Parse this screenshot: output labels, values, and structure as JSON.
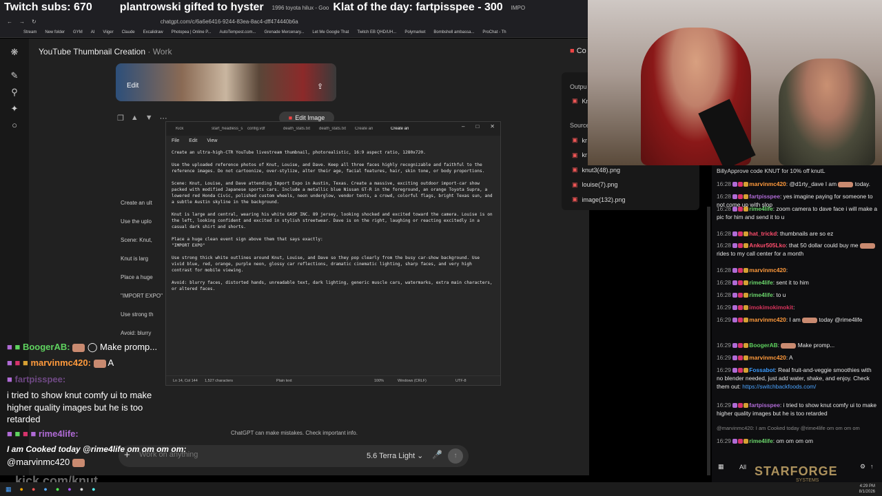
{
  "overlay_top": {
    "subs": "Twitch subs: 670",
    "gift": "plantrowski gifted to hyster",
    "tab1": "1996 toyota hilux - Goo",
    "klat": "Klat of the day: fartpisspee - 300",
    "tab2": "IMPO"
  },
  "browser": {
    "url": "chatgpt.com/c/6a6e6416-9244-83ea-8ac4-dff474440b6a",
    "bookmarks": [
      "Stream",
      "New folder",
      "GYM",
      "AI",
      "Viiger",
      "Claude",
      "Excalidraw",
      "Photopea | Online P...",
      "AutoTempest.com...",
      "Grenade Mercenary...",
      "Let Me Google That",
      "Twitch EB QHD/UH...",
      "Polymarket",
      "Bombshell ambassa...",
      "ProChat - Th"
    ]
  },
  "chatgpt": {
    "title": "YouTube Thumbnail Creation",
    "project": "Work",
    "edit_label": "Edit",
    "edit_image_label": "Edit Image",
    "disclaimer": "ChatGPT can make mistakes. Check important info.",
    "composer_placeholder": "Work on anything",
    "model": "5.6 Terra Light",
    "right_header_pdf": "Co",
    "right_output_label": "Outpu",
    "right_output_item": "Kn",
    "right_sources_label": "Source",
    "sources": [
      "kr",
      "kr",
      "knut3(48).png",
      "louise(7).png",
      "image(132).png"
    ],
    "bg_preview": [
      "Create an ult",
      "Use the uplo",
      "Scene: Knut,",
      "Knut is larg",
      "Place a huge",
      "\"IMPORT EXPO\"",
      "Use strong th",
      "Avoid: blurry"
    ]
  },
  "notepad": {
    "tabs": [
      "Kick",
      "start_headless_s",
      "config.vdf",
      "death_stats.txt",
      "death_stats.txt",
      "Create an",
      "Create an"
    ],
    "menu": [
      "File",
      "Edit",
      "View"
    ],
    "paragraphs": [
      "Create an ultra-high-CTR YouTube livestream thumbnail, photorealistic, 16:9 aspect ratio, 1280x720.",
      "Use the uploaded reference photos of Knut, Louise, and Dave. Keep all three faces highly recognizable and faithful to the reference images. Do not cartoonize, over-stylize, alter their age, facial features, hair, skin tone, or body proportions.",
      "Scene: Knut, Louise, and Dave attending Import Expo in Austin, Texas. Create a massive, exciting outdoor import-car show packed with modified Japanese sports cars. Include a metallic blue Nissan GT-R in the foreground, an orange Toyota Supra, a lowered red Honda Civic, polished custom wheels, neon underglow, vendor tents, a crowd, colorful flags, bright Texas sun, and a subtle Austin skyline in the background.",
      "Knut is large and central, wearing his white GASP INC. 89 jersey, looking shocked and excited toward the camera. Louise is on the left, looking confident and excited in stylish streetwear. Dave is on the right, laughing or reacting excitedly in a casual dark shirt and shorts.",
      "Place a huge clean event sign above them that says exactly:\n\"IMPORT EXPO\"",
      "Use strong thick white outlines around Knut, Louise, and Dave so they pop clearly from the busy car-show background. Use vivid blue, red, orange, purple neon, glossy car reflections, dramatic cinematic lighting, sharp faces, and very high contrast for mobile viewing.",
      "Avoid: blurry faces, distorted hands, unreadable text, dark lighting, generic muscle cars, watermarks, extra main characters, or altered faces."
    ],
    "status": {
      "pos": "Ln 14, Col 144",
      "chars": "1,527 characters",
      "format": "Plain text",
      "zoom": "100%",
      "eol": "Windows (CRLF)",
      "enc": "UTF-8"
    }
  },
  "overlay_chat": {
    "l1_name": "BoogerAB:",
    "l1_msg": "Make promp...",
    "l2_name": "marvinmc420:",
    "l2_msg": "A",
    "l3_name": "fartpisspee:",
    "l3_msg": "i tried to show knut comfy ui to make\nhigher quality images but he is too\nretarded",
    "l4_name": "rime4life:",
    "l5_msg": "I am Cooked today @rime4life om om om om:",
    "l6_msg": "@marvinmc420",
    "kick": "kick.com/knut"
  },
  "twitch_chat": {
    "top_msg": "BillyApprove code KNUT for 10% off knutL",
    "messages": [
      {
        "t": "16:28",
        "u": "marvinmc420",
        "c": "#ff9a3c",
        "m": ": @d1rty_dave I am",
        "m2": "today."
      },
      {
        "t": "16:28",
        "u": "fartpisspee",
        "c": "#b06bd6",
        "m": ": yes imagine paying for someone to not come up with slop"
      },
      {
        "t": "16:28",
        "u": "rime4life",
        "c": "#6bd66b",
        "m": ": zoom camera to dave face i will make a pic for him and send it to u"
      },
      {
        "t": "16:28",
        "u": "hat_trickd",
        "c": "#ff4d6d",
        "m": ": thumbnails are so ez"
      },
      {
        "t": "16:28",
        "u": "Ankur505Lko",
        "c": "#ff4d6d",
        "m": ": that 50 dollar could buy me",
        "m2": "rides to my call center for a month"
      },
      {
        "t": "16:28",
        "u": "marvinmc420",
        "c": "#ff9a3c",
        "m": ":"
      },
      {
        "t": "16:28",
        "u": "rime4life",
        "c": "#6bd66b",
        "m": ": sent it to him"
      },
      {
        "t": "16:28",
        "u": "rime4life",
        "c": "#6bd66b",
        "m": ": to u"
      },
      {
        "t": "16:29",
        "u": "imokimokimokit",
        "c": "#d6335b",
        "m": ":"
      },
      {
        "t": "16:29",
        "u": "marvinmc420",
        "c": "#ff9a3c",
        "m": ": I am",
        "m2": "today @rime4life"
      },
      {
        "t": "16:29",
        "u": "BoogerAB",
        "c": "#5fd35f",
        "m": ":",
        "m2": "Make promp..."
      },
      {
        "t": "16:29",
        "u": "marvinmc420",
        "c": "#ff9a3c",
        "m": ": A"
      },
      {
        "t": "16:29",
        "u": "Fossabot",
        "c": "#3b9cff",
        "m": ": Real fruit-and-veggie smoothies with no blender needed, just add water, shake, and enjoy. Check them out:",
        "link": "https://switchbackfoods.com/"
      },
      {
        "t": "16:29",
        "u": "fartpisspee",
        "c": "#b06bd6",
        "m": ": i tried to show knut comfy ui to make higher quality images but he is too retarded"
      },
      {
        "t": "",
        "u": "",
        "c": "",
        "m": "@marvinmc420: I am Cooked today @rime4life om om om om"
      },
      {
        "t": "16:29",
        "u": "rime4life",
        "c": "#6bd66b",
        "m": ": om om om om"
      }
    ],
    "bottom_label": "All"
  },
  "brand": {
    "name": "STARFORGE",
    "sub": "SYSTEMS"
  },
  "tray": {
    "time": "4:29 PM",
    "date": "8/1/2026"
  }
}
